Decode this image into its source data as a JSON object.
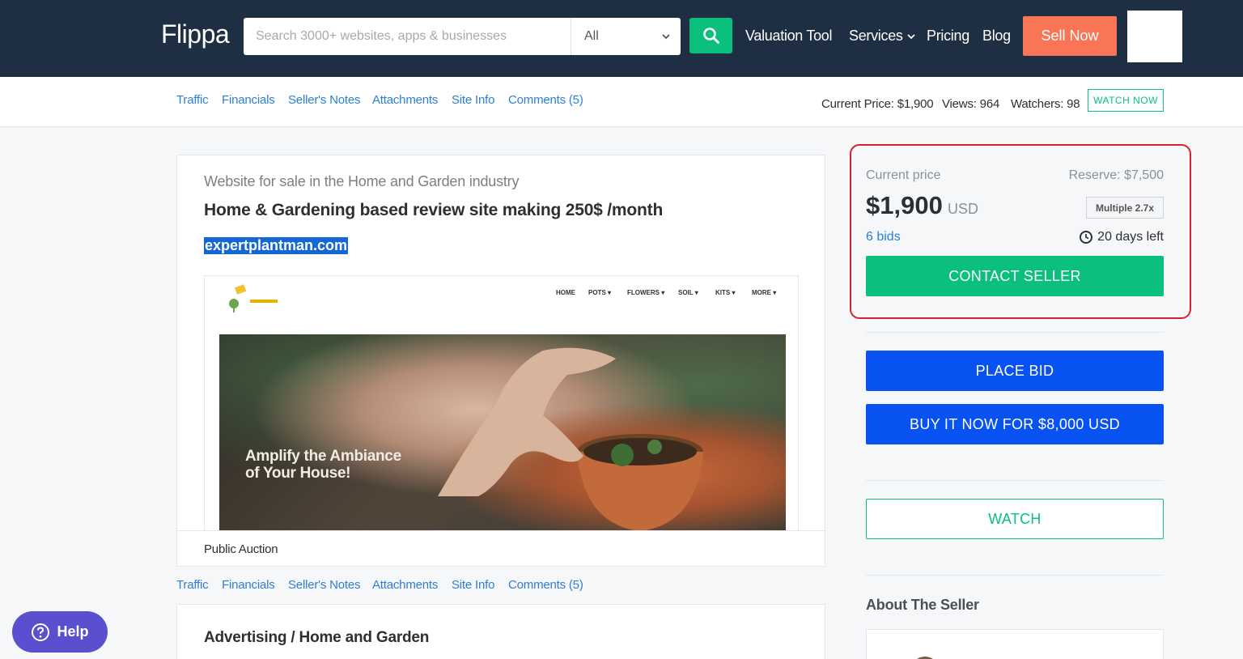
{
  "header": {
    "logo": "Flippa",
    "search_placeholder": "Search 3000+ websites, apps & businesses",
    "category_selected": "All",
    "nav": {
      "valuation": "Valuation Tool",
      "services": "Services",
      "pricing": "Pricing",
      "blog": "Blog"
    },
    "sell_now": "Sell Now"
  },
  "tabs": [
    "Traffic",
    "Financials",
    "Seller's Notes",
    "Attachments",
    "Site Info",
    "Comments (5)"
  ],
  "stats": {
    "current_price": "Current Price: $1,900",
    "views": "Views: 964",
    "watchers": "Watchers: 98",
    "watch_now": "WATCH NOW"
  },
  "listing": {
    "industry": "Website for sale in the Home and Garden industry",
    "title": "Home & Gardening based review site making 250$ /month",
    "domain": "expertplantman.com",
    "screenshot_nav": [
      "HOME",
      "POTS ▾",
      "FLOWERS ▾",
      "SOIL ▾",
      "KITS ▾",
      "MORE ▾"
    ],
    "hero_text_line1": "Amplify the Ambiance",
    "hero_text_line2": "of Your House!",
    "auction_type": "Public Auction",
    "category": "Advertising / Home and Garden"
  },
  "pricing": {
    "current_label": "Current price",
    "reserve": "Reserve: $7,500",
    "price": "$1,900",
    "currency": "USD",
    "multiple": "Multiple 2.7x",
    "bids": "6 bids",
    "time_left": "20 days left",
    "contact": "CONTACT SELLER",
    "place_bid": "PLACE BID",
    "buy_now": "BUY IT NOW FOR $8,000 USD",
    "watch": "WATCH",
    "about_seller": "About The Seller"
  },
  "help": "Help",
  "colors": {
    "header_bg": "#1e2e43",
    "green": "#0bbf7d",
    "blue": "#0952f2",
    "orange": "#fa7456",
    "highlight_red": "#d6202e",
    "help_purple": "#5a4fcf"
  }
}
